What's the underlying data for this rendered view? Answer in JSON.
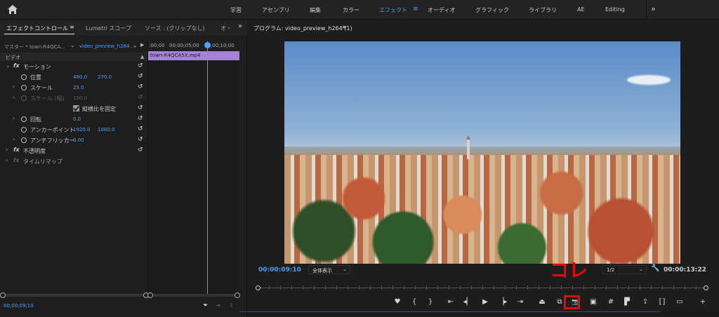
{
  "topbar": {
    "workspaces": [
      "学習",
      "アセンブリ",
      "編集",
      "カラー",
      "エフェクト",
      "オーディオ",
      "グラフィック",
      "ライブラリ",
      "AE",
      "Editing"
    ],
    "active": "エフェクト",
    "menu_glyph": "≡",
    "more_glyph": "»"
  },
  "left_panel": {
    "tabs": [
      "エフェクトコントロール",
      "Lumetri スコープ",
      "ソース : (クリップなし)",
      "オ・"
    ],
    "tab_menu_glyph": "≡",
    "more_glyph": "»",
    "master_label": "マスター * town-R4QCA...",
    "clip_label": "video_preview_h264 ...",
    "section": "ビデオ",
    "rows": [
      {
        "label": "モーション",
        "fx": "fx"
      },
      {
        "label": "位置",
        "v1": "480.0",
        "v2": "270.0"
      },
      {
        "label": "スケール",
        "v1": "25.0"
      },
      {
        "label": "スケール (幅)",
        "v1": "100.0"
      },
      {
        "label": "縦横比を固定"
      },
      {
        "label": "回転",
        "v1": "0.0"
      },
      {
        "label": "アンカーポイント",
        "v1": "1920.0",
        "v2": "1080.0"
      },
      {
        "label": "アンチフリッカー",
        "v1": "0.00"
      },
      {
        "label": "不透明度",
        "fx": "fx"
      },
      {
        "label": "タイムリマップ",
        "fx": "fx"
      }
    ],
    "timecode": "00;00;09;10",
    "mini_ruler": [
      ":00;00",
      "00;00;05;00",
      "00;00;10;00"
    ],
    "mini_clip": "town-R4QCA5X.mp4",
    "icons": {
      "filter": "filter-icon",
      "reset": "reset-icon",
      "stopwatch": "stopwatch-icon"
    }
  },
  "program": {
    "title": "プログラム: video_preview_h264 (1)",
    "menu_glyph": "≡",
    "current_time": "00:00:09:10",
    "fit": "全体表示",
    "resolution": "1/2",
    "duration": "00:00:13:22",
    "annotation": "コレ",
    "controls": [
      {
        "name": "add-marker-icon",
        "glyph": "♥"
      },
      {
        "name": "mark-in-icon",
        "glyph": "{"
      },
      {
        "name": "mark-out-icon",
        "glyph": "}"
      },
      {
        "name": "go-to-in-icon",
        "glyph": "⇤"
      },
      {
        "name": "step-back-icon",
        "glyph": "◂▏"
      },
      {
        "name": "play-icon",
        "glyph": "▶"
      },
      {
        "name": "step-forward-icon",
        "glyph": "▕▸"
      },
      {
        "name": "go-to-out-icon",
        "glyph": "⇥"
      },
      {
        "name": "lift-icon",
        "glyph": "⏏"
      },
      {
        "name": "extract-icon",
        "glyph": "⧉"
      },
      {
        "name": "export-frame-icon",
        "glyph": "📷"
      },
      {
        "name": "comparison-view-icon",
        "glyph": "▣"
      },
      {
        "name": "safe-margins-icon",
        "glyph": "#"
      },
      {
        "name": "proxy-icon",
        "glyph": "▛"
      },
      {
        "name": "share-icon",
        "glyph": "⇪"
      },
      {
        "name": "vr-icon",
        "glyph": "⟦⟧"
      },
      {
        "name": "fullscreen-icon",
        "glyph": "▭"
      },
      {
        "name": "button-editor-icon",
        "glyph": "+"
      }
    ],
    "accent": "#4d9fff",
    "highlight": "#e20b0b",
    "clip_color": "#a584d8"
  }
}
